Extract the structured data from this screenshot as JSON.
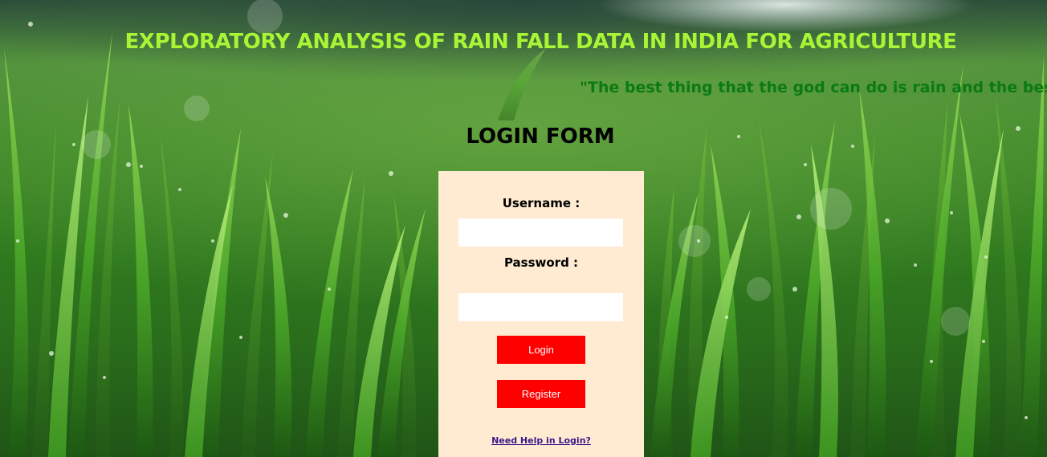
{
  "header": {
    "title": "EXPLORATORY ANALYSIS OF RAIN FALL DATA IN INDIA FOR AGRICULTURE",
    "marquee_text": "\"The best thing that the god can do is rain and the best thing"
  },
  "login_form": {
    "heading": "LOGIN FORM",
    "username_label": "Username :",
    "username_value": "",
    "password_label": "Password :",
    "password_value": "",
    "login_button": "Login",
    "register_button": "Register",
    "help_link": "Need Help in Login?"
  },
  "colors": {
    "title": "#a8f536",
    "marquee": "#0b7a14",
    "panel_background": "#ffebd1",
    "button_background": "#ff0000",
    "button_text": "#ffffff",
    "link": "#3a1a8a"
  },
  "background": {
    "description_icon": "grass-field-background"
  }
}
